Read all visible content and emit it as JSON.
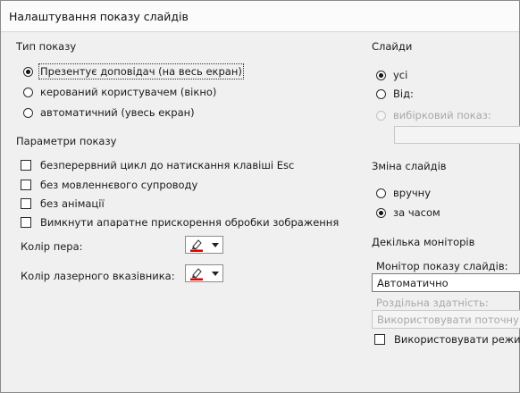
{
  "window": {
    "title": "Налаштування показу слайдів"
  },
  "show_type": {
    "title": "Тип показу",
    "options": [
      {
        "label": "Презентує доповідач (на весь екран)",
        "checked": true
      },
      {
        "label": "керований користувачем (вікно)",
        "checked": false
      },
      {
        "label": "автоматичний (увесь екран)",
        "checked": false
      }
    ]
  },
  "show_options": {
    "title": "Параметри показу",
    "checks": [
      {
        "label": "безперервний цикл до натискання клавіші Esc",
        "checked": false
      },
      {
        "label": "без мовленнєвого супроводу",
        "checked": false
      },
      {
        "label": "без анімації",
        "checked": false
      },
      {
        "label": "Вимкнути апаратне прискорення обробки зображення",
        "checked": false
      }
    ],
    "pen_color_label": "Колір пера:",
    "laser_color_label": "Колір лазерного вказівника:",
    "pen_color": "#e00000",
    "laser_color": "#e00000"
  },
  "slides": {
    "title": "Слайди",
    "all_label": "усі",
    "from_label": "Від:",
    "custom_label": "вибірковий показ:",
    "custom_value": ""
  },
  "advance": {
    "title": "Зміна слайдів",
    "manual_label": "вручну",
    "timings_label": "за часом"
  },
  "monitors": {
    "title": "Декілька моніторів",
    "monitor_label": "Монітор показу слайдів:",
    "monitor_value": "Автоматично",
    "resolution_label": "Роздільна здатність:",
    "resolution_value": "Використовувати поточну",
    "presenter_label": "Використовувати режи"
  }
}
